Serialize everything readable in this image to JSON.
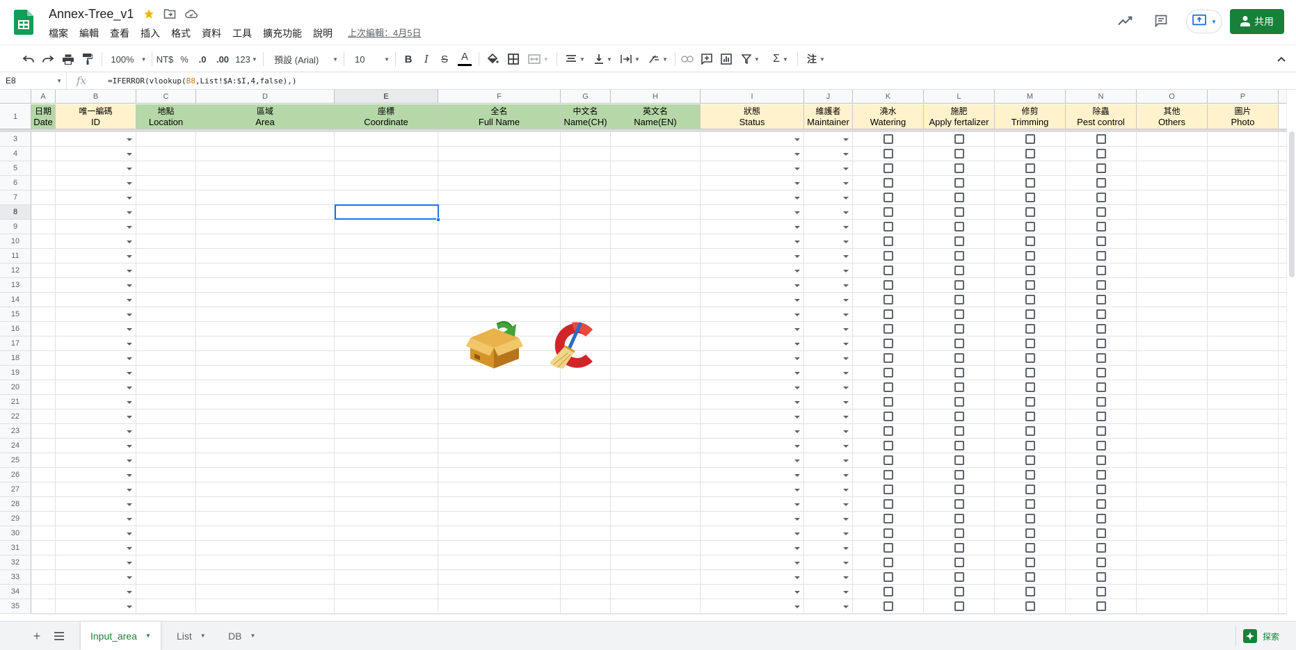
{
  "app": {
    "title": "Annex-Tree_v1",
    "menu": [
      "檔案",
      "編輯",
      "查看",
      "插入",
      "格式",
      "資料",
      "工具",
      "擴充功能",
      "說明"
    ],
    "last_edit": "上次編輯：4月5日",
    "share_label": "共用"
  },
  "toolbar": {
    "zoom": "100%",
    "currency": "NT$",
    "percent": "%",
    "decimal_dec": ".0",
    "decimal_inc": ".00",
    "number_format": "123",
    "font": "預設 (Arial)",
    "font_size": "10",
    "bold": "B",
    "italic": "I",
    "strike": "S",
    "text_color": "A",
    "input_tools": "注"
  },
  "formula_bar": {
    "cell_ref": "E8",
    "fx": "fx",
    "formula_pre": "=IFERROR(vlookup(",
    "formula_ref": "B8",
    "formula_post": ",List!$A:$I,4,false),)"
  },
  "columns": [
    {
      "letter": "A",
      "zh": "日期",
      "en": "Date",
      "color": "green"
    },
    {
      "letter": "B",
      "zh": "唯一編碼",
      "en": "ID",
      "color": "yellow"
    },
    {
      "letter": "C",
      "zh": "地點",
      "en": "Location",
      "color": "green"
    },
    {
      "letter": "D",
      "zh": "區域",
      "en": "Area",
      "color": "green"
    },
    {
      "letter": "E",
      "zh": "座標",
      "en": "Coordinate",
      "color": "green"
    },
    {
      "letter": "F",
      "zh": "全名",
      "en": "Full Name",
      "color": "green"
    },
    {
      "letter": "G",
      "zh": "中文名",
      "en": "Name(CH)",
      "color": "green"
    },
    {
      "letter": "H",
      "zh": "英文名",
      "en": "Name(EN)",
      "color": "green"
    },
    {
      "letter": "I",
      "zh": "狀態",
      "en": "Status",
      "color": "yellow"
    },
    {
      "letter": "J",
      "zh": "維護者",
      "en": "Maintainer",
      "color": "yellow"
    },
    {
      "letter": "K",
      "zh": "澆水",
      "en": "Watering",
      "color": "yellow"
    },
    {
      "letter": "L",
      "zh": "施肥",
      "en": "Apply fertalizer",
      "color": "yellow"
    },
    {
      "letter": "M",
      "zh": "修剪",
      "en": "Trimming",
      "color": "yellow"
    },
    {
      "letter": "N",
      "zh": "除蟲",
      "en": "Pest control",
      "color": "yellow"
    },
    {
      "letter": "O",
      "zh": "其他",
      "en": "Others",
      "color": "yellow"
    },
    {
      "letter": "P",
      "zh": "圖片",
      "en": "Photo",
      "color": "yellow"
    }
  ],
  "header_row_number": "1",
  "row_numbers": [
    "3",
    "4",
    "5",
    "6",
    "7",
    "8",
    "9",
    "10",
    "11",
    "12",
    "13",
    "14",
    "15",
    "16",
    "17",
    "18",
    "19",
    "20",
    "21",
    "22",
    "23",
    "24",
    "25",
    "26",
    "27",
    "28",
    "29",
    "30",
    "31",
    "32",
    "33",
    "34",
    "35"
  ],
  "selected": {
    "column": "E",
    "row": "8"
  },
  "dropdown_columns": [
    "B",
    "I",
    "J"
  ],
  "checkbox_columns": [
    "K",
    "L",
    "M",
    "N"
  ],
  "sheets": [
    {
      "name": "Input_area",
      "active": true
    },
    {
      "name": "List",
      "active": false
    },
    {
      "name": "DB",
      "active": false
    }
  ],
  "explore_label": "探索",
  "colors": {
    "header_green": "#b6d7a8",
    "header_yellow": "#fff2cc",
    "accent_green": "#188038",
    "selection_blue": "#1a73e8"
  }
}
